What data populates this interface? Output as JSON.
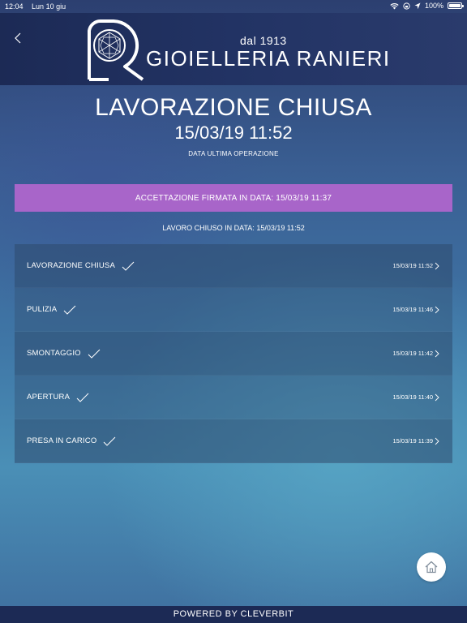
{
  "status_bar": {
    "time": "12:04",
    "date": "Lun 10 giu",
    "battery": "100%",
    "battery_level": 1.0
  },
  "header": {
    "back_label": "",
    "brand_since": "dal 1913",
    "brand_name": "GIOIELLERIA RANIERI"
  },
  "status": {
    "title": "LAVORAZIONE CHIUSA",
    "datetime": "15/03/19 11:52",
    "caption": "DATA ULTIMA OPERAZIONE"
  },
  "acceptance": {
    "text": "ACCETTAZIONE FIRMATA IN DATA: 15/03/19 11:37",
    "color": "#a865c9"
  },
  "closed_line": "LAVORO CHIUSO IN DATA: 15/03/19 11:52",
  "steps": [
    {
      "label": "LAVORAZIONE CHIUSA",
      "time": "15/03/19 11:52"
    },
    {
      "label": "PULIZIA",
      "time": "15/03/19 11:46"
    },
    {
      "label": "SMONTAGGIO",
      "time": "15/03/19 11:42"
    },
    {
      "label": "APERTURA",
      "time": "15/03/19 11:40"
    },
    {
      "label": "PRESA IN CARICO",
      "time": "15/03/19 11:39"
    }
  ],
  "footer": {
    "text": "POWERED BY CLEVERBIT"
  },
  "icons": {
    "back": "chevron-left-icon",
    "check": "check-icon",
    "row_chevron": "chevron-right-icon",
    "home": "home-icon",
    "wifi": "wifi-icon",
    "location": "location-icon"
  }
}
